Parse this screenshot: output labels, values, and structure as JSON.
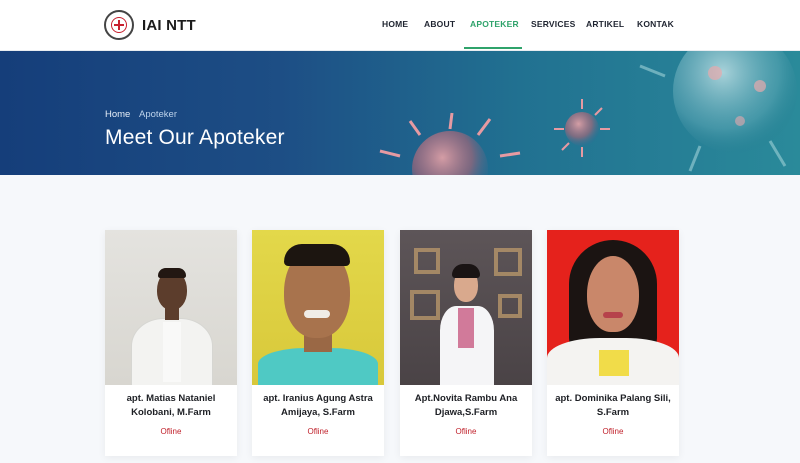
{
  "header": {
    "brand": "IAI NTT",
    "nav": [
      {
        "label": "HOME",
        "active": false
      },
      {
        "label": "ABOUT",
        "active": false
      },
      {
        "label": "APOTEKER",
        "active": true
      },
      {
        "label": "SERVICES",
        "active": false
      },
      {
        "label": "ARTIKEL",
        "active": false
      },
      {
        "label": "KONTAK",
        "active": false
      }
    ]
  },
  "hero": {
    "breadcrumb": {
      "home": "Home",
      "current": "Apoteker"
    },
    "title": "Meet Our Apoteker"
  },
  "cards": [
    {
      "name": "apt. Matias Nataniel Kolobani, M.Farm",
      "status": "Ofline"
    },
    {
      "name": "apt. Iranius Agung Astra Amijaya, S.Farm",
      "status": "Ofline"
    },
    {
      "name": "Apt.Novita Rambu Ana Djawa,S.Farm",
      "status": "Ofline"
    },
    {
      "name": "apt. Dominika Palang Sili, S.Farm",
      "status": "Ofline"
    }
  ],
  "colors": {
    "accent": "#2fa36b",
    "status": "#c0212b",
    "hero_start": "#153e7a",
    "hero_end": "#2a8a9a"
  }
}
